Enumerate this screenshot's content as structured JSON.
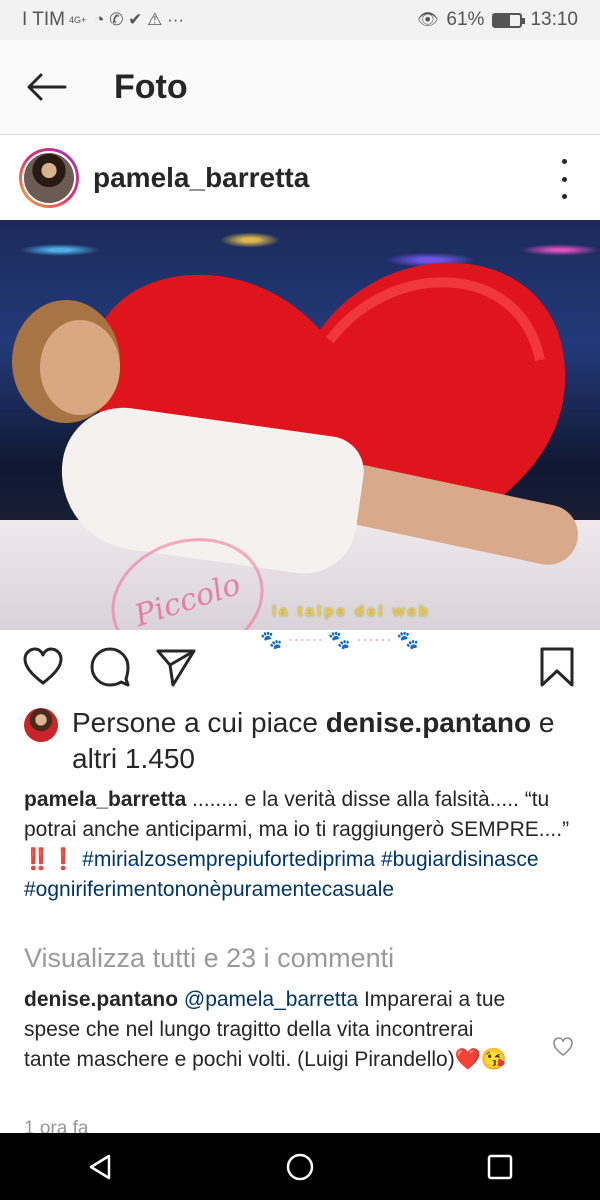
{
  "status_bar": {
    "carrier": "I TIM",
    "network": "4G+",
    "glyphs": "◔ ✆ ✔ ⚠ ···",
    "battery_percent": "61%",
    "battery_level": 0.61,
    "time": "13:10"
  },
  "header": {
    "title": "Foto"
  },
  "post": {
    "username": "pamela_barretta",
    "photo_watermark": "la talpe del web",
    "photo_stamp": "Piccolo News",
    "likes_prefix": "Persone a cui piace ",
    "likes_user": "denise.pantano",
    "likes_suffix": " e altri 1.450",
    "caption": {
      "username": "pamela_barretta",
      "text": " ........ e la verità disse alla falsità..... “tu potrai anche anticiparmi, ma io ti raggiungerò SEMPRE....” ‼️❗ ",
      "hashtags": [
        "#mirialzosemprepiufortediprima",
        "#bugiardisinasce",
        "#ogniriferimentononèpuramentecasuale"
      ]
    },
    "view_all_comments": "Visualizza tutti e 23 i commenti",
    "comment": {
      "username": "denise.pantano",
      "mention": "@pamela_barretta",
      "text": " Imparerai a tue spese che nel lungo tragitto della vita incontrerai tante maschere e pochi volti. (Luigi Pirandello)❤️😘"
    },
    "timestamp": "1 ora fa"
  },
  "icons": {
    "back": "arrow-left-icon",
    "more": "more-vertical-icon",
    "like": "heart-outline-icon",
    "comment": "comment-bubble-icon",
    "share": "paper-plane-icon",
    "save": "bookmark-icon",
    "comment_like": "heart-small-icon",
    "nav_back": "triangle-back-icon",
    "nav_home": "circle-home-icon",
    "nav_recents": "square-recents-icon"
  },
  "colors": {
    "text": "#262626",
    "secondary": "#999999",
    "hashtag": "#003569",
    "header_bg": "#fafafa",
    "status_bg": "#f2f2f2"
  }
}
